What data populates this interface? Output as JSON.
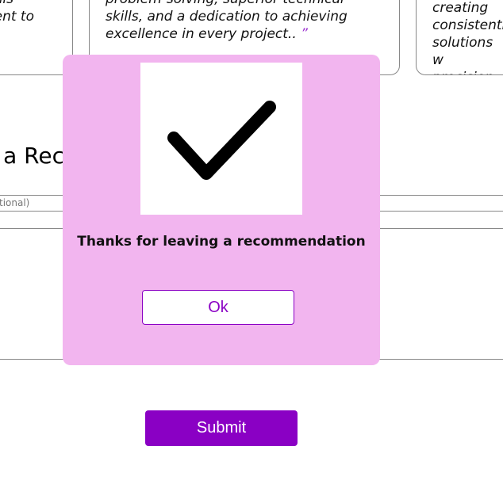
{
  "cards": [
    {
      "text": "his\nent to",
      "quote": ""
    },
    {
      "text": "problem-solving, superior technical skills, and a dedication to achieving excellence in every project..",
      "quote": "”"
    },
    {
      "text": "in creating\nconsistently\nsolutions w\nprecision",
      "quote": "”"
    }
  ],
  "form": {
    "heading": "e a Rec",
    "input_placeholder": "tional)",
    "submit_label": "Submit"
  },
  "modal": {
    "icon": "checkmark-icon",
    "message": "Thanks for leaving a recommendation",
    "ok_label": "Ok"
  },
  "colors": {
    "accent": "#8a00c4",
    "modal_bg": "#f2b5ef"
  }
}
